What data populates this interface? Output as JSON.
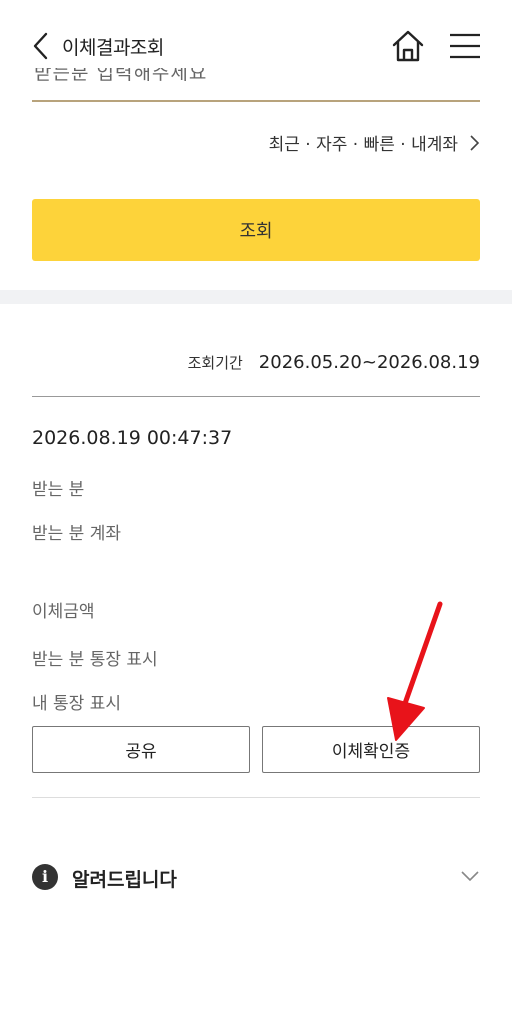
{
  "header": {
    "title": "이체결과조회",
    "back_icon": "chevron-left-icon",
    "home_icon": "home-icon",
    "menu_icon": "hamburger-menu-icon"
  },
  "input": {
    "partial_text": "받는분 입력해주세요"
  },
  "shortcuts": {
    "label": "최근 · 자주 · 빠른 · 내계좌"
  },
  "search_button": {
    "label": "조회"
  },
  "period": {
    "label": "조회기간",
    "value": "2026.05.20~2026.08.19"
  },
  "transaction": {
    "datetime": "2026.08.19 00:47:37",
    "labels": [
      "받는 분",
      "받는 분 계좌",
      "이체금액",
      "받는 분 통장 표시",
      "내 통장 표시"
    ]
  },
  "actions": {
    "share_label": "공유",
    "confirm_label": "이체확인증"
  },
  "notice": {
    "title": "알려드립니다",
    "icon": "info-icon"
  },
  "colors": {
    "accent_yellow": "#fdd33a",
    "underline_gold": "#b8a37c",
    "annotation_red": "#e8131a"
  }
}
